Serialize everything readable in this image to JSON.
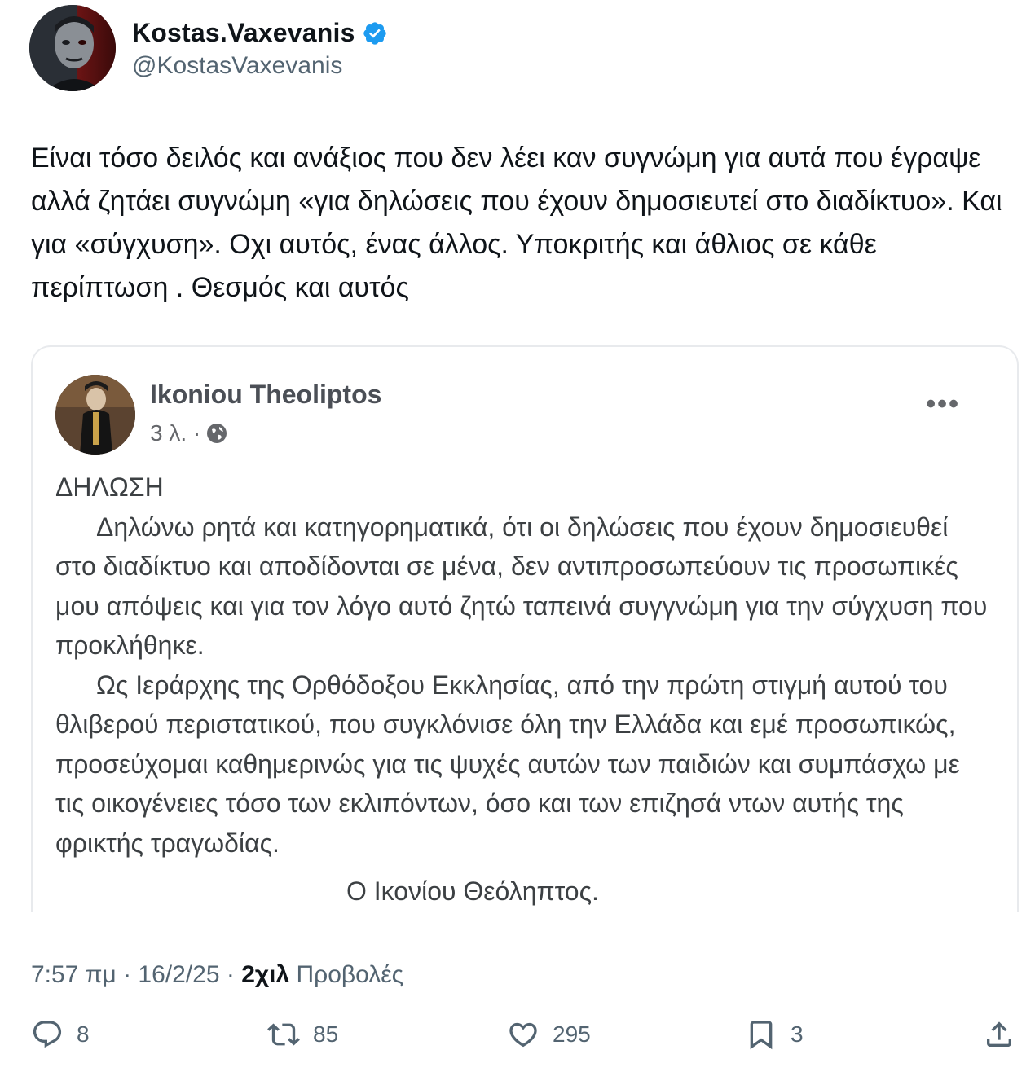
{
  "author": {
    "display_name": "Kostas.Vaxevanis",
    "handle": "@KostasVaxevanis",
    "verified_icon": "verified-badge-icon",
    "accent_color": "#1d9bf0"
  },
  "tweet": {
    "text": "Είναι τόσο δειλός και ανάξιος που δεν λέει καν συγνώμη για αυτά που έγραψε αλλά ζητάει συγνώμη «για δηλώσεις που έχουν δημοσιευτεί στο διαδίκτυο». Και για «σύγχυση». Οχι αυτός, ένας άλλος. Υποκριτής και άθλιος σε κάθε περίπτωση . Θεσμός και αυτός"
  },
  "embedded_post": {
    "author": "Ikoniou Theoliptos",
    "time": "3 λ. ·",
    "more_label": "•••",
    "heading": "ΔΗΛΩΣΗ",
    "paragraph_1": "Δηλώνω ρητά και κατηγορηματικά, ότι οι δηλώσεις που έχουν δημοσιευθεί στο διαδίκτυο και αποδίδονται σε μένα,  δεν αντιπροσωπεύουν τις προσωπικές μου απόψεις και για τον λόγο αυτό ζητώ ταπεινά συγγνώμη για την σύγχυση που προκλήθηκε.",
    "paragraph_2": "Ως Ιεράρχης της Ορθόδοξου Εκκλησίας, από την πρώτη στιγμή αυτού του θλιβερού περιστατικού, που συγκλόνισε όλη την Ελλάδα και εμέ προσωπικώς, προσεύχομαι καθημερινώς για τις ψυχές αυτών των παιδιών και συμπάσχω με τις οικογένειες τόσο των εκλιπόντων, όσο και των επιζησά ντων αυτής της φρικτής τραγωδίας.",
    "signature": "Ο Ικονίου Θεόληπτος."
  },
  "meta": {
    "time": "7:57 πμ",
    "separator": "·",
    "date": "16/2/25",
    "views_count": "2χιλ",
    "views_label": "Προβολές"
  },
  "actions": {
    "replies": "8",
    "reposts": "85",
    "likes": "295",
    "bookmarks": "3"
  }
}
